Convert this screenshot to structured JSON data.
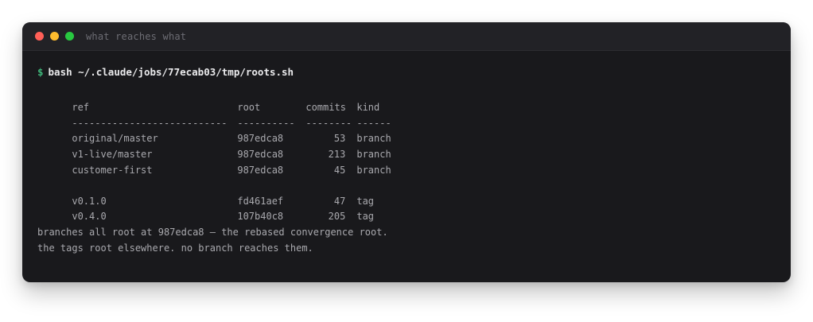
{
  "window": {
    "title": "what reaches what"
  },
  "prompt": {
    "symbol": "$",
    "command": "bash ~/.claude/jobs/77ecab03/tmp/roots.sh"
  },
  "table": {
    "headers": {
      "ref": "ref",
      "root": "root",
      "commits": "commits",
      "kind": "kind"
    },
    "separators": {
      "ref": "---------------------------",
      "root": "----------",
      "commits": "--------",
      "kind": "------"
    },
    "branches": [
      {
        "ref": "original/master",
        "root": "987edca8",
        "commits": "53",
        "kind": "branch"
      },
      {
        "ref": "v1-live/master",
        "root": "987edca8",
        "commits": "213",
        "kind": "branch"
      },
      {
        "ref": "customer-first",
        "root": "987edca8",
        "commits": "45",
        "kind": "branch"
      }
    ],
    "tags": [
      {
        "ref": "v0.1.0",
        "root": "fd461aef",
        "commits": "47",
        "kind": "tag"
      },
      {
        "ref": "v0.4.0",
        "root": "107b40c8",
        "commits": "205",
        "kind": "tag"
      }
    ]
  },
  "notes": [
    "branches all root at 987edca8 — the rebased convergence root.",
    "the tags root elsewhere. no branch reaches them."
  ]
}
